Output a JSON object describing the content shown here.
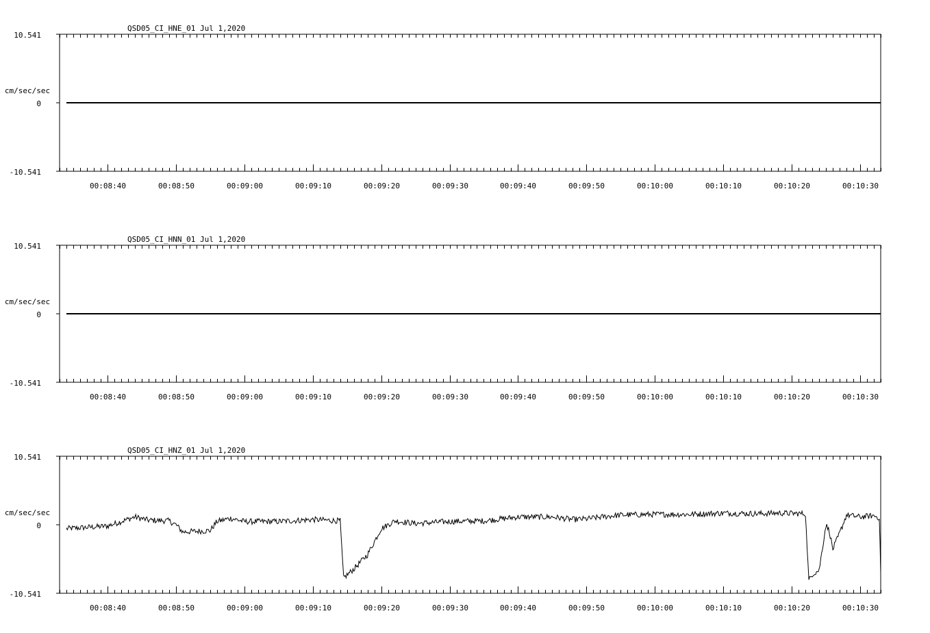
{
  "chart_data": [
    {
      "type": "line",
      "title": "QSD05_CI_HNE_01  Jul 1,2020",
      "ylabel": "cm/sec/sec",
      "ytick_labels": [
        "10.541",
        "0",
        "-10.541"
      ],
      "ylim": [
        -10.541,
        10.541
      ],
      "xlim": [
        "00:08:33",
        "00:10:33"
      ],
      "xtick_labels": [
        "00:08:40",
        "00:08:50",
        "00:09:00",
        "00:09:10",
        "00:09:20",
        "00:09:30",
        "00:09:40",
        "00:09:50",
        "00:10:00",
        "00:10:10",
        "00:10:20",
        "00:10:30"
      ],
      "series": [
        {
          "x": [
            "00:08:34",
            "00:10:33"
          ],
          "y": [
            0,
            0
          ]
        }
      ]
    },
    {
      "type": "line",
      "title": "QSD05_CI_HNN_01  Jul 1,2020",
      "ylabel": "cm/sec/sec",
      "ytick_labels": [
        "10.541",
        "0",
        "-10.541"
      ],
      "ylim": [
        -10.541,
        10.541
      ],
      "xlim": [
        "00:08:33",
        "00:10:33"
      ],
      "xtick_labels": [
        "00:08:40",
        "00:08:50",
        "00:09:00",
        "00:09:10",
        "00:09:20",
        "00:09:30",
        "00:09:40",
        "00:09:50",
        "00:10:00",
        "00:10:10",
        "00:10:20",
        "00:10:30"
      ],
      "series": [
        {
          "x": [
            "00:08:34",
            "00:10:33"
          ],
          "y": [
            0,
            0
          ]
        }
      ]
    },
    {
      "type": "line",
      "title": "QSD05_CI_HNZ_01  Jul 1,2020",
      "ylabel": "cm/sec/sec",
      "ytick_labels": [
        "10.541",
        "0",
        "-10.541"
      ],
      "ylim": [
        -10.541,
        10.541
      ],
      "xlim": [
        "00:08:33",
        "00:10:33"
      ],
      "xtick_labels": [
        "00:08:40",
        "00:08:50",
        "00:09:00",
        "00:09:10",
        "00:09:20",
        "00:09:30",
        "00:09:40",
        "00:09:50",
        "00:10:00",
        "00:10:10",
        "00:10:20",
        "00:10:30"
      ],
      "series": [
        {
          "x": [
            "00:08:34",
            "00:08:37",
            "00:08:40",
            "00:08:42",
            "00:08:44",
            "00:08:46",
            "00:08:49",
            "00:08:50",
            "00:08:51",
            "00:08:53",
            "00:08:55",
            "00:08:56",
            "00:08:58",
            "00:09:00",
            "00:09:05",
            "00:09:10",
            "00:09:14",
            "00:09:14.5",
            "00:09:16",
            "00:09:18",
            "00:09:20",
            "00:09:22",
            "00:09:25",
            "00:09:30",
            "00:09:35",
            "00:09:40",
            "00:09:45",
            "00:09:48",
            "00:09:50",
            "00:09:53",
            "00:09:55",
            "00:10:00",
            "00:10:05",
            "00:10:10",
            "00:10:15",
            "00:10:18",
            "00:10:22",
            "00:10:22.5",
            "00:10:23",
            "00:10:24",
            "00:10:25",
            "00:10:25.5",
            "00:10:26",
            "00:10:27",
            "00:10:28",
            "00:10:30",
            "00:10:32",
            "00:10:32.8",
            "00:10:33"
          ],
          "y": [
            -0.6,
            -0.4,
            -0.2,
            0.5,
            1.2,
            0.7,
            0.6,
            0.0,
            -1.1,
            -1.0,
            -0.9,
            0.5,
            1.0,
            0.5,
            0.5,
            0.8,
            0.6,
            -8.2,
            -6.8,
            -4.6,
            -0.6,
            0.6,
            0.2,
            0.5,
            0.6,
            1.2,
            1.2,
            0.8,
            0.9,
            1.3,
            1.5,
            1.6,
            1.6,
            1.8,
            1.7,
            1.8,
            1.7,
            -8.6,
            -7.6,
            -7.0,
            0.0,
            -1.0,
            -3.8,
            -1.3,
            1.5,
            1.2,
            1.4,
            1.1,
            -7.2
          ]
        }
      ]
    }
  ]
}
